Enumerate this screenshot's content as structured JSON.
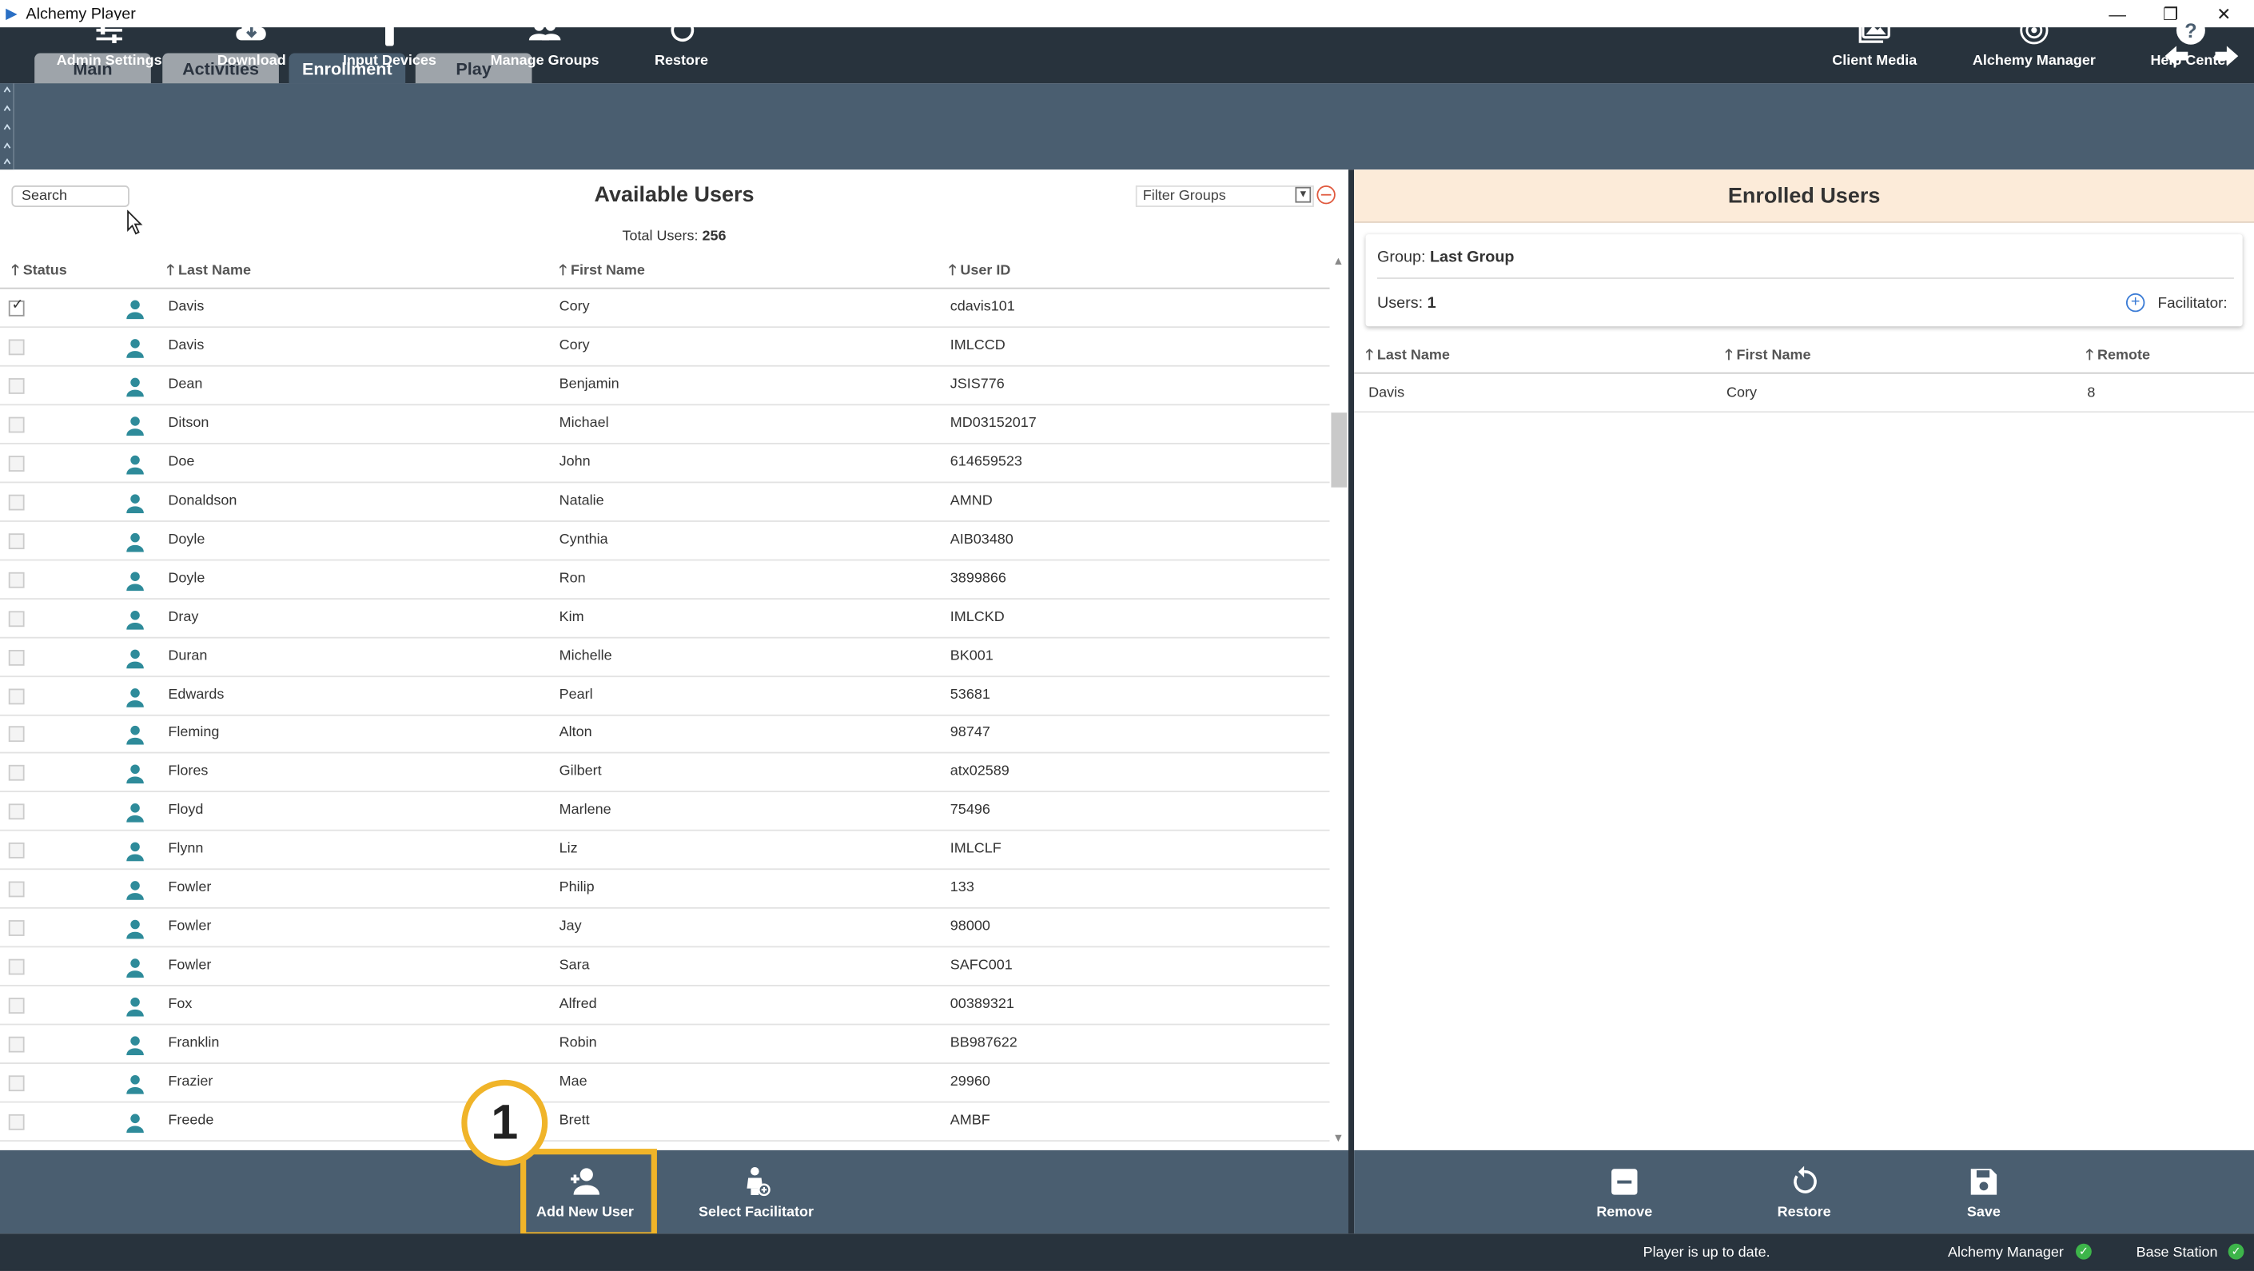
{
  "window": {
    "title": "Alchemy Player"
  },
  "tabs": [
    {
      "label": "Main"
    },
    {
      "label": "Activities"
    },
    {
      "label": "Enrollment"
    },
    {
      "label": "Play"
    }
  ],
  "toolbar": {
    "left": [
      {
        "label": "Admin Settings",
        "icon": "sliders-icon"
      },
      {
        "label": "Download",
        "icon": "cloud-download-icon"
      },
      {
        "label": "Input Devices",
        "icon": "remote-icon"
      },
      {
        "label": "Manage Groups",
        "icon": "group-icon"
      },
      {
        "label": "Restore",
        "icon": "restore-icon"
      }
    ],
    "right": [
      {
        "label": "Client Media",
        "icon": "images-icon"
      },
      {
        "label": "Alchemy Manager",
        "icon": "manager-icon"
      },
      {
        "label": "Help Center",
        "icon": "help-icon"
      }
    ]
  },
  "available": {
    "search_placeholder": "Search",
    "title": "Available Users",
    "total_label": "Total Users:",
    "total_value": "256",
    "filter_placeholder": "Filter Groups",
    "columns": [
      "Status",
      "Last Name",
      "First Name",
      "User ID"
    ],
    "rows": [
      {
        "checked": true,
        "last": "Davis",
        "first": "Cory",
        "id": "cdavis101"
      },
      {
        "checked": false,
        "last": "Davis",
        "first": "Cory",
        "id": "IMLCCD"
      },
      {
        "checked": false,
        "last": "Dean",
        "first": "Benjamin",
        "id": "JSIS776"
      },
      {
        "checked": false,
        "last": "Ditson",
        "first": "Michael",
        "id": "MD03152017"
      },
      {
        "checked": false,
        "last": "Doe",
        "first": "John",
        "id": "614659523"
      },
      {
        "checked": false,
        "last": "Donaldson",
        "first": "Natalie",
        "id": "AMND"
      },
      {
        "checked": false,
        "last": "Doyle",
        "first": "Cynthia",
        "id": "AIB03480"
      },
      {
        "checked": false,
        "last": "Doyle",
        "first": "Ron",
        "id": "3899866"
      },
      {
        "checked": false,
        "last": "Dray",
        "first": "Kim",
        "id": "IMLCKD"
      },
      {
        "checked": false,
        "last": "Duran",
        "first": "Michelle",
        "id": "BK001"
      },
      {
        "checked": false,
        "last": "Edwards",
        "first": "Pearl",
        "id": "53681"
      },
      {
        "checked": false,
        "last": "Fleming",
        "first": "Alton",
        "id": "98747"
      },
      {
        "checked": false,
        "last": "Flores",
        "first": "Gilbert",
        "id": "atx02589"
      },
      {
        "checked": false,
        "last": "Floyd",
        "first": "Marlene",
        "id": "75496"
      },
      {
        "checked": false,
        "last": "Flynn",
        "first": "Liz",
        "id": "IMLCLF"
      },
      {
        "checked": false,
        "last": "Fowler",
        "first": "Philip",
        "id": "133"
      },
      {
        "checked": false,
        "last": "Fowler",
        "first": "Jay",
        "id": "98000"
      },
      {
        "checked": false,
        "last": "Fowler",
        "first": "Sara",
        "id": "SAFC001"
      },
      {
        "checked": false,
        "last": "Fox",
        "first": "Alfred",
        "id": "00389321"
      },
      {
        "checked": false,
        "last": "Franklin",
        "first": "Robin",
        "id": "BB987622"
      },
      {
        "checked": false,
        "last": "Frazier",
        "first": "Mae",
        "id": "29960"
      },
      {
        "checked": false,
        "last": "Freede",
        "first": "Brett",
        "id": "AMBF"
      }
    ]
  },
  "enrolled": {
    "title": "Enrolled Users",
    "group_label": "Group:",
    "group_value": "Last Group",
    "users_label": "Users:",
    "users_value": "1",
    "facilitator_label": "Facilitator:",
    "columns": [
      "Last Name",
      "First Name",
      "Remote"
    ],
    "rows": [
      {
        "last": "Davis",
        "first": "Cory",
        "remote": "8"
      }
    ]
  },
  "bottom_left": [
    {
      "label": "Add New User",
      "icon": "add-user-icon"
    },
    {
      "label": "Select Facilitator",
      "icon": "facilitator-icon"
    }
  ],
  "bottom_right": [
    {
      "label": "Remove",
      "icon": "remove-icon"
    },
    {
      "label": "Restore",
      "icon": "restore-icon"
    },
    {
      "label": "Save",
      "icon": "save-icon"
    }
  ],
  "callout": {
    "number": "1",
    "color": "#f0b429"
  },
  "status": {
    "message": "Player is up to date.",
    "manager": "Alchemy Manager",
    "base": "Base Station"
  },
  "colors": {
    "toolbar": "#4a5e70",
    "dark": "#28333d",
    "accent_teal": "#2e8b9a",
    "enrolled_header": "#fcebd9"
  }
}
